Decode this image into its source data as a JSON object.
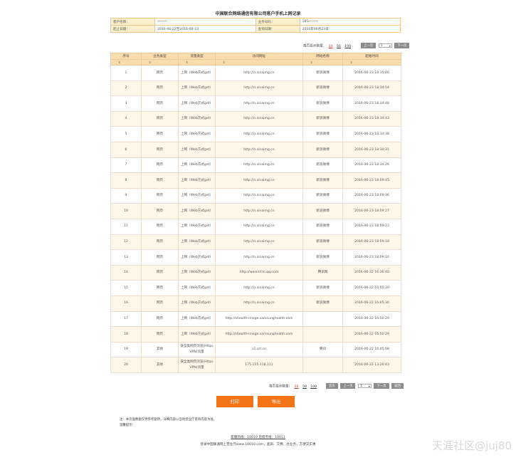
{
  "title": "中国联合网络通信有限公司客户手机上网记录",
  "info": {
    "customer_label": "客户名称：",
    "phone_label": "业务号码：",
    "phone_value": "185",
    "period_label": "起止日期：",
    "period_value": "2016-06-22至2016-06-23",
    "query_label": "查询日期：",
    "query_value": "2016年06月23日"
  },
  "pager": {
    "page_size_label": "每页显示数量：",
    "sizes": [
      "20",
      "50",
      "100"
    ],
    "first": "首页",
    "prev": "上一页",
    "page_value": "1",
    "next": "下一页",
    "back": "返回"
  },
  "table": {
    "headers": [
      "序号",
      "业务类型",
      "流量类型",
      "访问网址",
      "网站名称",
      "起始时间"
    ],
    "sort_glyph": "⇕",
    "rows": [
      [
        "1",
        "网页",
        "上网（Web方式get）",
        "http://n.sinaimg.cn",
        "新浪微博",
        "2016-06-23 18:35:00"
      ],
      [
        "2",
        "网页",
        "上网（Web方式get）",
        "http://n.sinaimg.cn",
        "新浪微博",
        "2016-06-23 18:34:54"
      ],
      [
        "3",
        "网页",
        "上网（Web方式get）",
        "http://n.sinaimg.cn",
        "新浪微博",
        "2016-06-23 18:34:48"
      ],
      [
        "4",
        "网页",
        "上网（Web方式get）",
        "http://n.sinaimg.cn",
        "新浪微博",
        "2016-06-23 18:34:43"
      ],
      [
        "5",
        "网页",
        "上网（Web方式get）",
        "http://n.sinaimg.cn",
        "新浪微博",
        "2016-06-23 18:34:38"
      ],
      [
        "6",
        "网页",
        "上网（Web方式get）",
        "http://n.sinaimg.cn",
        "新浪微博",
        "2016-06-23 18:34:31"
      ],
      [
        "7",
        "网页",
        "上网（Web方式get）",
        "http://n.sinaimg.cn",
        "新浪微博",
        "2016-06-23 18:34:26"
      ],
      [
        "8",
        "网页",
        "上网（Web方式get）",
        "http://n.sinaimg.cn",
        "新浪微博",
        "2016-06-23 18:09:45"
      ],
      [
        "9",
        "网页",
        "上网（Web方式get）",
        "http://n.sinaimg.cn",
        "新浪微博",
        "2016-06-23 18:09:36"
      ],
      [
        "10",
        "网页",
        "上网（Web方式get）",
        "http://n.sinaimg.cn",
        "新浪微博",
        "2016-06-23 18:09:27"
      ],
      [
        "11",
        "网页",
        "上网（Web方式get）",
        "http://n.sinaimg.cn",
        "新浪微博",
        "2016-06-23 18:09:23"
      ],
      [
        "12",
        "网页",
        "上网（Web方式get）",
        "http://n.sinaimg.cn",
        "新浪微博",
        "2016-06-23 18:09:18"
      ],
      [
        "13",
        "网页",
        "上网（Web方式get）",
        "http://n.sinaimg.cn",
        "新浪微博",
        "2016-06-23 18:09:10"
      ],
      [
        "14",
        "网页",
        "上网（Web方式get）",
        "http://weixinf.tc.qq.com",
        "腾讯网",
        "2016-06-22 16:36:40"
      ],
      [
        "15",
        "网页",
        "上网（Web方式get）",
        "http://n.sinaimg.cn",
        "新浪微博",
        "2016-06-22 16:05:30"
      ],
      [
        "16",
        "网页",
        "上网（Web方式get）",
        "http://n.sinaimg.cn",
        "新浪微博",
        "2016-06-22 16:05:30"
      ],
      [
        "17",
        "网页",
        "上网（Web方式get）",
        "http://shealth-image.samsunghealth.com",
        "",
        "2016-06-22 16:50:29"
      ],
      [
        "18",
        "网页",
        "上网（Web方式get）",
        "http://shealth-image.samsunghealth.com",
        "",
        "2016-06-22 16:50:29"
      ],
      [
        "19",
        "其他",
        "安全类网页浏览(Https VPN)流量",
        "s1.url.cn",
        "腾讯",
        "2016-06-22 16:45:08"
      ],
      [
        "20",
        "其他",
        "安全类网页浏览(Https VPN)流量",
        "175.155.118.111",
        "",
        "2016-06-22 13:26:43"
      ]
    ]
  },
  "actions": {
    "print": "打印",
    "export": "导出"
  },
  "notes": {
    "line1": "注：本页面数据仅供参考使用，详细内容以当地营业厅查询内容为准。",
    "line2": "温馨提示："
  },
  "footer": {
    "hotline": "客服热线：10010  充值专线：10011",
    "site": "登录中国联通网上营业厅www.10010.com，查询、交费、办业务，方便又实惠"
  },
  "watermark": "天涯社区@juj80"
}
